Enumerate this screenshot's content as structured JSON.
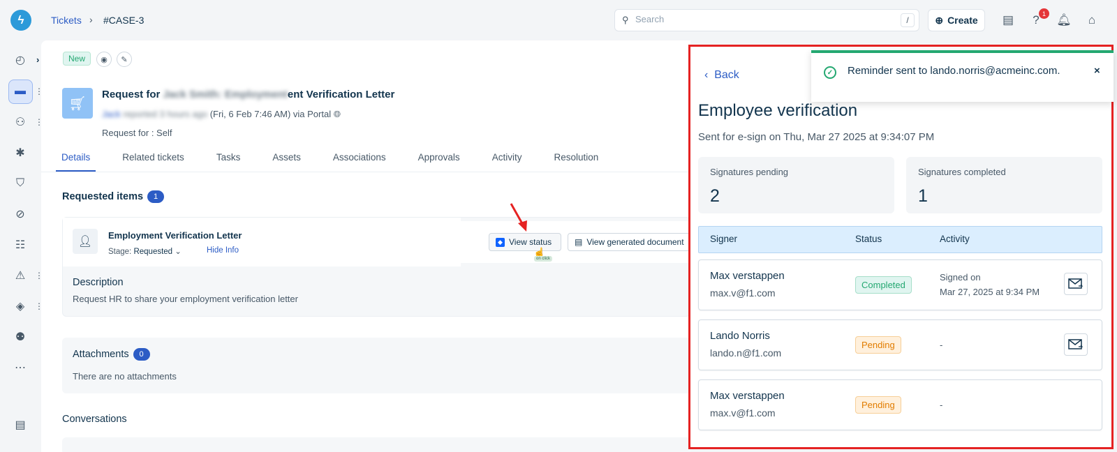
{
  "header": {
    "breadcrumb_link": "Tickets",
    "breadcrumb_sep": "›",
    "breadcrumb_current": "#CASE-3",
    "search_placeholder": "Search",
    "search_shortcut": "/",
    "create_label": "Create",
    "notification_count": "1"
  },
  "ticket": {
    "status_badge": "New",
    "title_prefix": "Request for ",
    "title_blurred": "Jack Smith: Employment",
    "title_suffix": "ent Verification Letter",
    "requester_blurred": "Jack",
    "meta_blurred": "reported 3 hours ago",
    "meta_rest": "(Fri, 6 Feb 7:46 AM) via Portal",
    "request_for": "Request for :  Self"
  },
  "tabs": [
    "Details",
    "Related tickets",
    "Tasks",
    "Assets",
    "Associations",
    "Approvals",
    "Activity",
    "Resolution"
  ],
  "requested_items": {
    "heading": "Requested items",
    "count": "1",
    "item_name": "Employment Verification Letter",
    "stage_label": "Stage:",
    "stage_value": "Requested",
    "hide_info": "Hide Info",
    "view_status": "View status",
    "view_generated": "View generated document",
    "cursor_tip": "on click",
    "description_title": "Description",
    "description_text": "Request HR to share your employment verification letter"
  },
  "attachments": {
    "heading": "Attachments",
    "count": "0",
    "empty_text": "There are no attachments"
  },
  "conversations": {
    "heading": "Conversations"
  },
  "panel": {
    "back_label": "Back",
    "title": "Employee verification",
    "subtitle": "Sent for e-sign on Thu, Mar 27 2025 at 9:34:07 PM",
    "pending_label": "Signatures pending",
    "pending_value": "2",
    "completed_label": "Signatures completed",
    "completed_value": "1",
    "col_signer": "Signer",
    "col_status": "Status",
    "col_activity": "Activity",
    "toast_text": "Reminder sent to lando.norris@acmeinc.com.",
    "signers": [
      {
        "name": "Max verstappen",
        "email": "max.v@f1.com",
        "status": "Completed",
        "activity_1": "Signed on",
        "activity_2": "Mar 27, 2025 at 9:34 PM"
      },
      {
        "name": "Lando Norris",
        "email": "lando.n@f1.com",
        "status": "Pending",
        "activity_1": "-"
      },
      {
        "name": "Max verstappen",
        "email": "max.v@f1.com",
        "status": "Pending",
        "activity_1": "-"
      }
    ]
  },
  "colors": {
    "accent": "#2c5cc5",
    "highlight_border": "#e52222",
    "success": "#24a871",
    "warning": "#e17c00"
  }
}
